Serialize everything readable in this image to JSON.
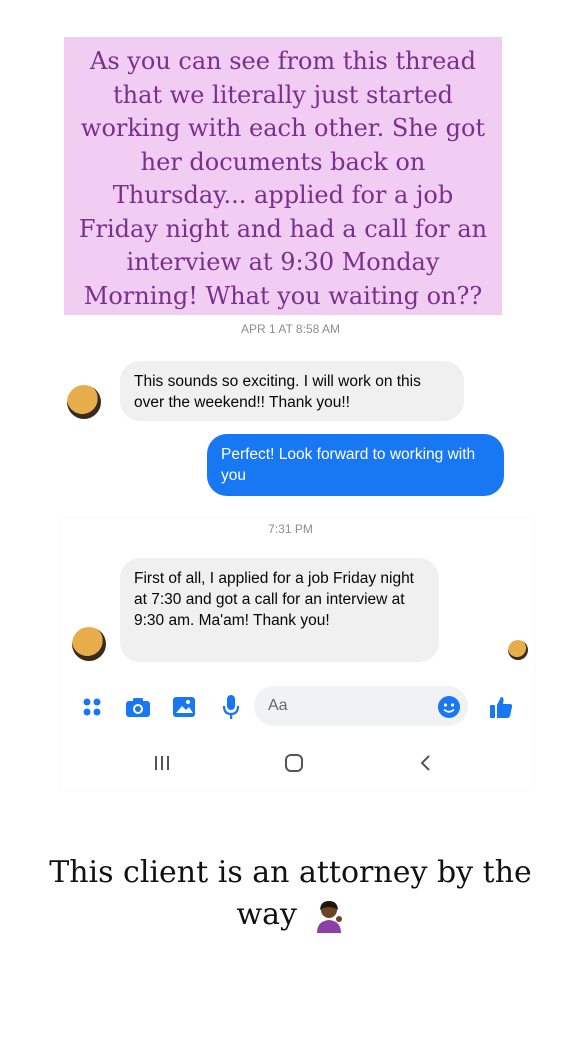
{
  "caption_text": "As you can see from this thread\nthat we literally just started\nworking with each other. She got\nher documents back on\nThursday... applied for a job\nFriday night and had a call for an\ninterview at 9:30 Monday\nMorning! What you waiting on??",
  "thread": {
    "timestamp_1": "APR 1 AT 8:58 AM",
    "message_1": "This sounds so exciting. I will work on this over the weekend!! Thank you!!",
    "message_2": "Perfect! Look forward to working with you",
    "timestamp_2": "7:31 PM",
    "message_3": "First of all, I applied for a job Friday night at 7:30 and got a call for an interview at 9:30 am. Ma'am! Thank you!"
  },
  "composer": {
    "placeholder": "Aa",
    "icons": [
      "apps-icon",
      "camera-icon",
      "gallery-icon",
      "microphone-icon",
      "emoji-icon",
      "like-icon"
    ]
  },
  "nav": {
    "icons": [
      "recent-apps-icon",
      "home-icon",
      "back-icon"
    ]
  },
  "footer_text": "This client is an attorney by the way",
  "colors": {
    "caption_bg": "#f1cdf4",
    "caption_text": "#7a2f8d",
    "messenger_blue": "#1877f2",
    "incoming_bg": "#f0f0f0"
  }
}
